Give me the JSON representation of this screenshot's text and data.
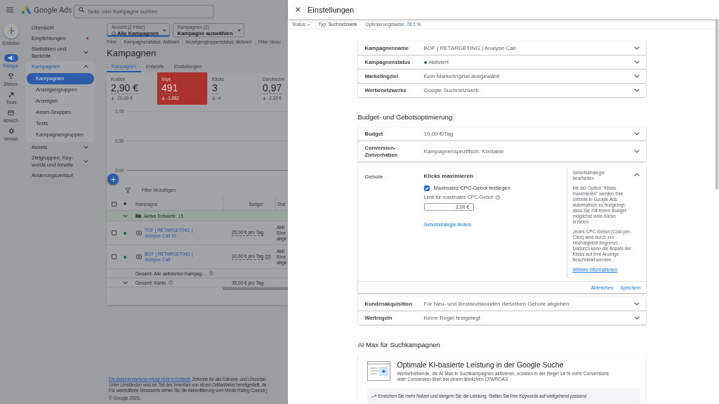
{
  "top_bar": {
    "product": "Google Ads",
    "search": {
      "placeholder": "Seite oder Kampagne suchen"
    }
  },
  "rail": {
    "create": "Erstellen",
    "items": [
      {
        "label": "Kampa-",
        "selected": true
      },
      {
        "label": "Zielvor-",
        "selected": false
      },
      {
        "label": "Tools",
        "selected": false
      },
      {
        "label": "Abrech-",
        "selected": false
      },
      {
        "label": "Verwal-",
        "selected": false
      }
    ]
  },
  "sidebar": {
    "items": [
      {
        "label": "Übersicht",
        "kind": "link",
        "selected": false,
        "notification": false
      },
      {
        "label": "Empfehlungen",
        "kind": "link",
        "selected": false,
        "notification": true
      },
      {
        "label": "Statistiken und Berichte",
        "kind": "group",
        "selected": false,
        "notification": false,
        "expanded": false
      },
      {
        "label": "Kampagnen",
        "kind": "group",
        "selected": true,
        "notification": false,
        "expanded": true,
        "children": [
          {
            "label": "Kampagnen",
            "selected": true
          },
          {
            "label": "Anzeigengruppen",
            "selected": false
          },
          {
            "label": "Anzeigen",
            "selected": false
          },
          {
            "label": "Asset-Gruppen",
            "selected": false
          },
          {
            "label": "Tests",
            "selected": false
          },
          {
            "label": "Kampagnengruppen",
            "selected": false
          }
        ]
      },
      {
        "label": "Assets",
        "kind": "group",
        "selected": false,
        "notification": false,
        "expanded": false
      },
      {
        "label": "Zielgruppen, Key-words und Inhalte",
        "kind": "group",
        "selected": false,
        "notification": false,
        "expanded": false
      },
      {
        "label": "Änderungsverlauf",
        "kind": "link",
        "selected": false,
        "notification": false
      }
    ]
  },
  "main": {
    "view_filters": [
      {
        "label": "Ansicht (2 Filter)",
        "value": "Alle Kampagnen",
        "selected": true
      },
      {
        "label": "Kampagnen (2)",
        "value": "Kampagne auswählen",
        "selected": false
      }
    ],
    "filter_bar": {
      "label": "Filter",
      "chips": [
        "Kampagnenstatus: Aktiviert",
        "Anzeigengruppenstatus: Aktiviert"
      ],
      "add": "Filter hinzu"
    },
    "title": "Kampagnen",
    "tabs": [
      {
        "label": "Kampagnen",
        "selected": true
      },
      {
        "label": "Entwürfe",
        "selected": false
      },
      {
        "label": "Einstellungen",
        "selected": false
      }
    ],
    "metrics": [
      {
        "label": "Kosten",
        "value": "2,90 €",
        "change": "-20,00 €",
        "selected": false
      },
      {
        "label": "Impr.",
        "value": "491",
        "change": "-1.882",
        "selected": true
      },
      {
        "label": "Klicks",
        "value": "3",
        "change": "-4",
        "selected": false
      },
      {
        "label": "Durchschn",
        "value": "0,97",
        "change": "-2,30 €",
        "selected": false
      }
    ],
    "chart": {
      "y_ticks": [
        "1,00",
        "0,50",
        "0,00"
      ]
    },
    "table_filter": "Filter hinzufügen",
    "table": {
      "header_checked": false,
      "columns": [
        "Kampagne",
        "Budget",
        "Stat"
      ],
      "group": {
        "label": "Aktive Entwürfe: 15",
        "expanded": true
      },
      "rows": [
        {
          "name": "TOF | RETARGETING | Analyse Call #2",
          "budget": "25,00 € pro Tag",
          "status": [
            "Akti",
            "Eine",
            "abge"
          ],
          "checked": false,
          "enabled": true,
          "limited": false
        },
        {
          "name": "BOF | RETARGETING | Analyse Call",
          "budget": "10,00 € pro Tag",
          "status": [
            "Akti",
            "Eine",
            "abge"
          ],
          "checked": false,
          "enabled": true,
          "limited": true
        }
      ],
      "totals": [
        {
          "kind": "summary",
          "label": "Gesamt: Alle aktivierten Kampag…"
        },
        {
          "kind": "expandable",
          "label": "Gesamt: Konto",
          "budget": "35,00 € pro Tag"
        }
      ]
    },
    "footer": {
      "link": "Die Berichterstellung erfolgt nicht in Echtzeit.",
      "lines": [
        "Zeitzone für alle Datums- und Uhrzeitan",
        "Unter Umständen wird ein Teil des Inventars von einem Drittanbieter bereitgestellt, de",
        "Für akkreditierte Messwerte sehen Sie die Akkreditierung vom Media Rating Council ("
      ],
      "copyright": "© Google 2026."
    }
  },
  "drawer": {
    "title": "Einstellungen",
    "meta": [
      {
        "label": "Status:",
        "value": "–",
        "kind": "text"
      },
      {
        "label": "Typ:",
        "value": "Suchnetzwerk",
        "kind": "text"
      },
      {
        "label": "Optimierungsfaktor:",
        "value": "76,1 %",
        "kind": "link"
      }
    ],
    "general": [
      {
        "label": "Kampagnenname",
        "value": "BOF | RETARGETING | Analyse Call",
        "kind": "text",
        "expanded": false
      },
      {
        "label": "Kampagnenstatus",
        "value": "Aktiviert",
        "kind": "status",
        "expanded": false
      },
      {
        "label": "Marketingziel",
        "value": "Kein Marketingziel ausgewählt",
        "kind": "text",
        "expanded": false
      },
      {
        "label": "Werbenetzwerke",
        "value": "Google Suchnetzwerk",
        "kind": "text",
        "expanded": false
      }
    ],
    "sections": [
      {
        "title": "Budget- und Gebotsoptimierung",
        "rows": [
          {
            "label": "Budget",
            "value": "10,00 €/Tag",
            "kind": "text",
            "expanded": false
          },
          {
            "label": "Conversion-Zielvorhaben",
            "value": "Kampagnenspezifisch: Kontakte",
            "kind": "text",
            "expanded": false
          },
          {
            "label": "Gebote",
            "kind": "bidding",
            "expanded": true,
            "strategy": "Klicks maximieren",
            "max_cpc": {
              "label": "Maximales CPC-Gebot festlegen",
              "checked": true
            },
            "limit": {
              "label": "Limit für maximales CPC-Gebot",
              "value": "2,00 €"
            },
            "change_link": "Gebotsstrategie ändern",
            "help": {
              "title": "Gebotsstrategie bearbeiten",
              "paragraphs": [
                "Mit der Option \"Klicks maximieren\" werden Ihre Gebote in Google Ads automatisch so festgelegt, dass Sie mit Ihrem Budget möglichst viele Klicks erzielen.",
                "Jedes CPC-Gebot (Cost-per-Click) wird durch ein Höchstgebot begrenzt. Dadurch kann die Anzahl der Klicks auf Ihre Anzeige beschränkt werden."
              ],
              "link": "Weitere Informationen"
            },
            "actions": [
              "Abbrechen",
              "Speichern"
            ]
          },
          {
            "label": "Kundenakquisition",
            "value": "Für Neu- und Bestandskunden dieselben Gebote abgeben",
            "kind": "text",
            "expanded": false
          },
          {
            "label": "Wertregeln",
            "value": "Keine Regel festgelegt",
            "kind": "text",
            "expanded": false
          }
        ]
      }
    ],
    "ai_max": {
      "title": "AI Max für Suchkampagnen",
      "heading": "Optimale KI-basierte Leistung in der Google Suche",
      "description": "Werbetreibende, die AI Max in Suchkampagnen aktivieren, erzielen in der Regel 14 % mehr Conversions oder Conversion-Wert bei einem ähnlichen CPA/ROAS",
      "tip": "Erreichen Sie mehr Nutzer und steigern Sie die Leistung. Stellen Sie Ihre Keywords auf weitgehend passend"
    }
  }
}
